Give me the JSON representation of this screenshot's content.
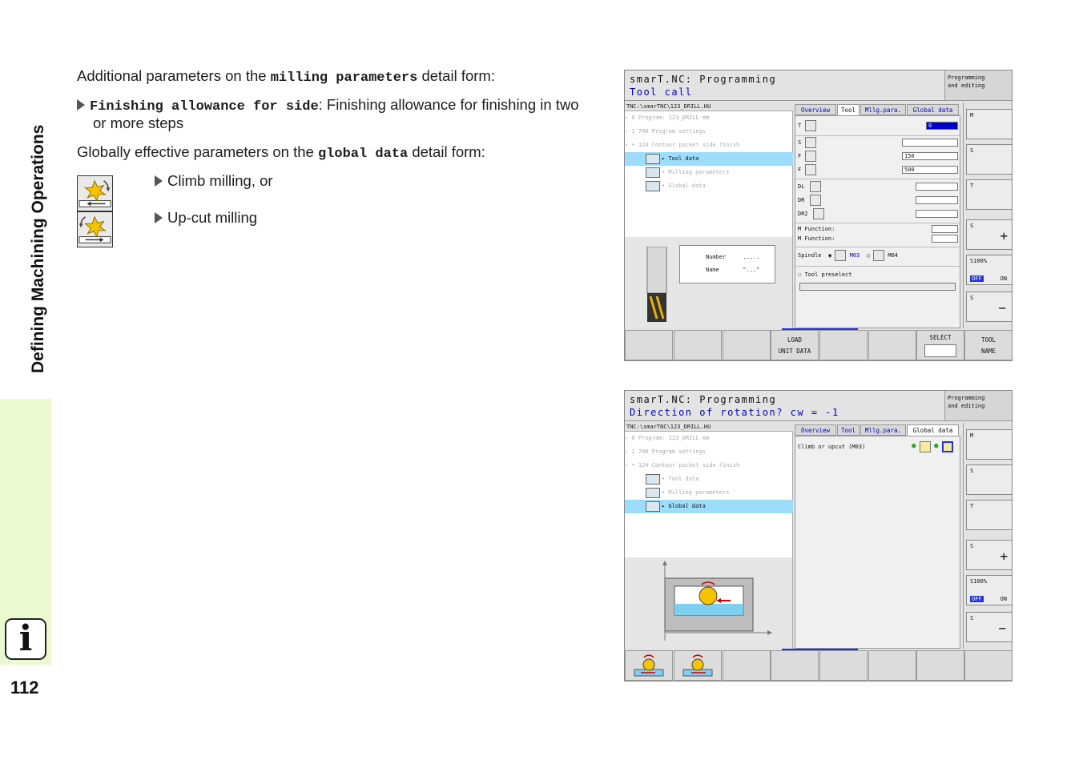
{
  "sidebar": {
    "title": "Defining Machining Operations",
    "page_number": "112",
    "info_icon": "i"
  },
  "body": {
    "p1_pre": "Additional parameters on the ",
    "p1_code": "milling parameters",
    "p1_post": " detail form:",
    "b1_code": "Finishing allowance for side",
    "b1_rest": ": Finishing allowance for finishing in two",
    "b1_cont": "or more steps",
    "p2_pre": "Globally effective parameters on the ",
    "p2_code": "global data",
    "p2_post": " detail form:",
    "opt1": "Climb milling, or",
    "opt2": "Up-cut milling"
  },
  "icons": {
    "climb": "climb-milling-icon",
    "upcut": "upcut-milling-icon"
  },
  "screen1": {
    "title": "smarT.NC: Programming",
    "subtitle": "Tool call",
    "mode_line1": "Programming",
    "mode_line2": "and editing",
    "path": "TNC:\\smarTNC\\123_DRILL.HU",
    "tree": [
      "▿ 0  Program: 123_DRILL mm",
      "› 1  700 Program settings",
      "▿ • 124 Contour pocket side finish",
      "▸  Tool data",
      "•  Milling parameters",
      "•  Global data"
    ],
    "tabs": [
      "Overview",
      "Tool",
      "Mllg.para.",
      "Global data"
    ],
    "fields": {
      "t_label": "T",
      "t_value": "0",
      "s_label": "S",
      "f1_label": "F",
      "f1_value": "150",
      "f2_label": "F",
      "f2_value": "500",
      "dl": "DL",
      "dr": "DR",
      "dr2": "DR2",
      "mf1": "M Function:",
      "mf2": "M Function:",
      "spindle": "Spindle",
      "m03": "M03",
      "m04": "M04",
      "preselect": "Tool preselect"
    },
    "preview": {
      "number_label": "Number",
      "number_value": ".....",
      "name_label": "Name",
      "name_value": "\"...\""
    },
    "vsoft": {
      "m": "M",
      "s": "S",
      "t": "T",
      "s_plus": "S",
      "s100": "S100%",
      "off": "OFF",
      "on": "ON",
      "s_minus": "S"
    },
    "hsoft": {
      "load_line1": "LOAD",
      "load_line2": "UNIT DATA",
      "select": "SELECT",
      "tool_line1": "TOOL",
      "tool_line2": "NAME"
    }
  },
  "screen2": {
    "title": "smarT.NC: Programming",
    "subtitle": "Direction of rotation? cw = -1",
    "mode_line1": "Programming",
    "mode_line2": "and editing",
    "path": "TNC:\\smarTNC\\123_DRILL.HU",
    "tree": [
      "▿ 0  Program: 123_DRILL mm",
      "› 1  700 Program settings",
      "▿ • 124 Contour pocket side finish",
      "•  Tool data",
      "•  Milling parameters",
      "▸  Global data"
    ],
    "tabs": [
      "Overview",
      "Tool",
      "Mllg.para.",
      "Global data"
    ],
    "field": "Climb or upcut (M03)",
    "vsoft": {
      "m": "M",
      "s": "S",
      "t": "T",
      "s_plus": "S",
      "s100": "S100%",
      "off": "OFF",
      "on": "ON",
      "s_minus": "S"
    }
  }
}
